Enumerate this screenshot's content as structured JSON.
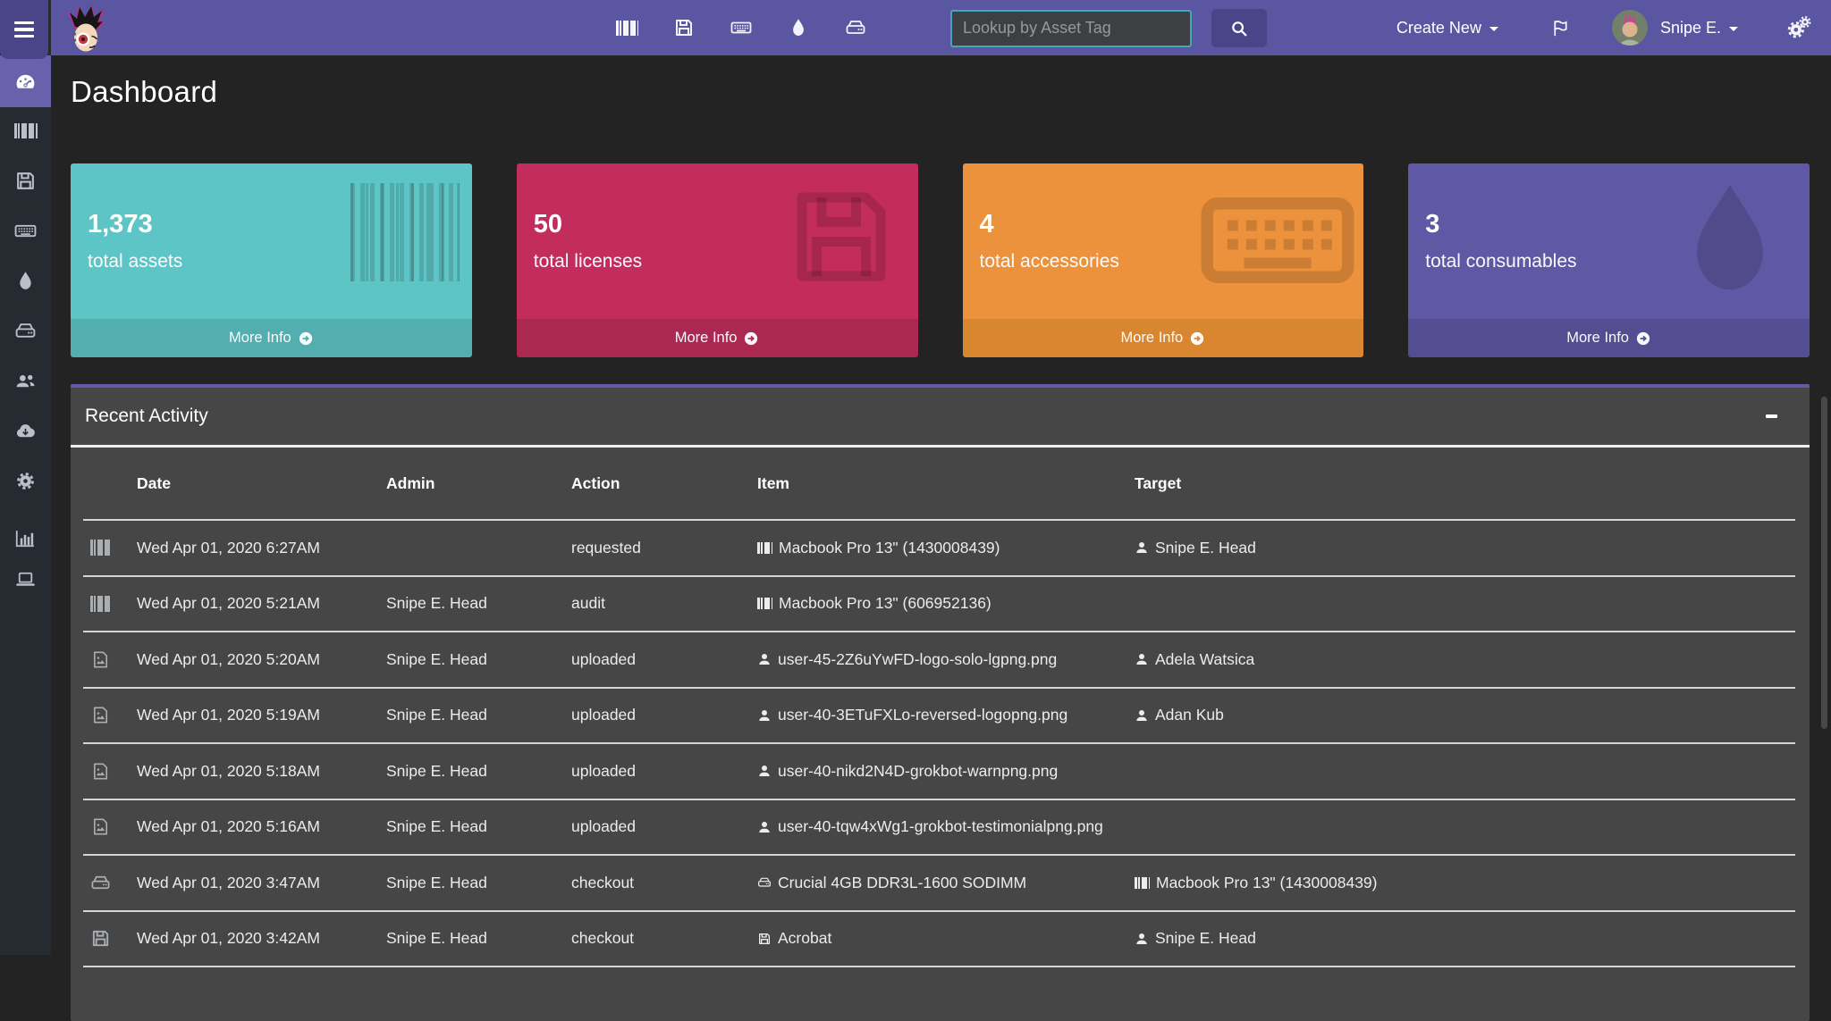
{
  "theme": {
    "accent": "#5b56a2",
    "accent_dark": "#4a4489",
    "sidebar_bg": "#262b32",
    "sidebar_active": "#6a61ac",
    "page_bg": "#232324",
    "panel_bg": "#464646",
    "panel_border": "#615aa8",
    "search_border": "#47a4ba"
  },
  "navbar": {
    "search_placeholder": "Lookup by Asset Tag",
    "create_new_label": "Create New",
    "user_name": "Snipe E.",
    "quick_icons": [
      "barcode-assets",
      "save-licenses",
      "keyboard-accessories",
      "droplet-consumables",
      "drive-components"
    ],
    "right_icons": [
      "flag",
      "avatar",
      "gears"
    ]
  },
  "sidebar": {
    "items": [
      {
        "name": "dashboard",
        "icon": "gauge",
        "active": true
      },
      {
        "name": "assets",
        "icon": "barcode",
        "active": false
      },
      {
        "name": "licenses",
        "icon": "save",
        "active": false
      },
      {
        "name": "accessories",
        "icon": "keyboard",
        "active": false
      },
      {
        "name": "consumables",
        "icon": "droplet",
        "active": false
      },
      {
        "name": "components",
        "icon": "hard-drive",
        "active": false
      },
      {
        "name": "people",
        "icon": "users",
        "active": false
      },
      {
        "name": "import",
        "icon": "cloud-download",
        "active": false
      },
      {
        "name": "settings",
        "icon": "gear",
        "active": false
      },
      {
        "name": "reports",
        "icon": "bar-chart",
        "active": false
      },
      {
        "name": "models",
        "icon": "laptop",
        "active": false
      }
    ]
  },
  "page": {
    "title": "Dashboard"
  },
  "info_boxes": [
    {
      "value": "1,373",
      "label": "total assets",
      "more_info_label": "More Info",
      "icon": "barcode",
      "color": "#5ec5c6",
      "footer_color": "#53aeb0"
    },
    {
      "value": "50",
      "label": "total licenses",
      "more_info_label": "More Info",
      "icon": "save",
      "color": "#c22d5e",
      "footer_color": "#ab2853"
    },
    {
      "value": "4",
      "label": "total accessories",
      "more_info_label": "More Info",
      "icon": "keyboard",
      "color": "#ec923c",
      "footer_color": "#d98630"
    },
    {
      "value": "3",
      "label": "total consumables",
      "more_info_label": "More Info",
      "icon": "droplet",
      "color": "#5f58a4",
      "footer_color": "#544d92"
    }
  ],
  "recent_activity": {
    "title": "Recent Activity",
    "columns": [
      "Date",
      "Admin",
      "Action",
      "Item",
      "Target"
    ],
    "rows": [
      {
        "icon": "barcode",
        "date": "Wed Apr 01, 2020 6:27AM",
        "admin": "",
        "action": "requested",
        "item_icon": "barcode",
        "item": "Macbook Pro 13\" (1430008439)",
        "target_icon": "user",
        "target": "Snipe E. Head"
      },
      {
        "icon": "barcode",
        "date": "Wed Apr 01, 2020 5:21AM",
        "admin": "Snipe E. Head",
        "action": "audit",
        "item_icon": "barcode",
        "item": "Macbook Pro 13\" (606952136)",
        "target_icon": "",
        "target": ""
      },
      {
        "icon": "file-image",
        "date": "Wed Apr 01, 2020 5:20AM",
        "admin": "Snipe E. Head",
        "action": "uploaded",
        "item_icon": "user",
        "item": "user-45-2Z6uYwFD-logo-solo-lgpng.png",
        "target_icon": "user",
        "target": "Adela Watsica"
      },
      {
        "icon": "file-image",
        "date": "Wed Apr 01, 2020 5:19AM",
        "admin": "Snipe E. Head",
        "action": "uploaded",
        "item_icon": "user",
        "item": "user-40-3ETuFXLo-reversed-logopng.png",
        "target_icon": "user",
        "target": "Adan Kub"
      },
      {
        "icon": "file-image",
        "date": "Wed Apr 01, 2020 5:18AM",
        "admin": "Snipe E. Head",
        "action": "uploaded",
        "item_icon": "user",
        "item": "user-40-nikd2N4D-grokbot-warnpng.png",
        "target_icon": "",
        "target": ""
      },
      {
        "icon": "file-image",
        "date": "Wed Apr 01, 2020 5:16AM",
        "admin": "Snipe E. Head",
        "action": "uploaded",
        "item_icon": "user",
        "item": "user-40-tqw4xWg1-grokbot-testimonialpng.png",
        "target_icon": "",
        "target": ""
      },
      {
        "icon": "hard-drive",
        "date": "Wed Apr 01, 2020 3:47AM",
        "admin": "Snipe E. Head",
        "action": "checkout",
        "item_icon": "hard-drive",
        "item": "Crucial 4GB DDR3L-1600 SODIMM",
        "target_icon": "barcode",
        "target": "Macbook Pro 13\" (1430008439)"
      },
      {
        "icon": "save",
        "date": "Wed Apr 01, 2020 3:42AM",
        "admin": "Snipe E. Head",
        "action": "checkout",
        "item_icon": "save",
        "item": "Acrobat",
        "target_icon": "user",
        "target": "Snipe E. Head"
      }
    ]
  }
}
